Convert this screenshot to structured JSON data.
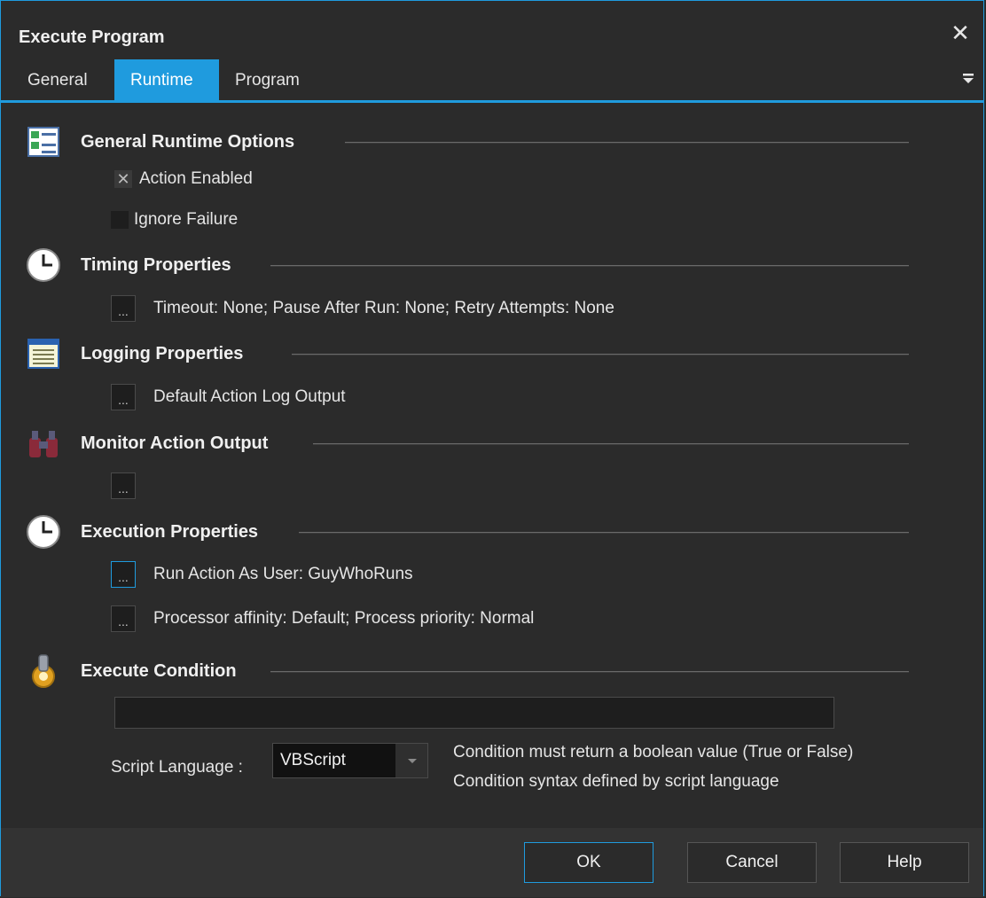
{
  "window": {
    "title": "Execute Program"
  },
  "tabs": [
    {
      "label": "General",
      "active": false
    },
    {
      "label": "Runtime",
      "active": true
    },
    {
      "label": "Program",
      "active": false
    }
  ],
  "sections": {
    "general_runtime": {
      "title": "General Runtime Options",
      "action_enabled": {
        "label": "Action Enabled",
        "checked": true
      },
      "ignore_failure": {
        "label": "Ignore Failure",
        "checked": false
      }
    },
    "timing": {
      "title": "Timing Properties",
      "summary": "Timeout: None; Pause After Run: None; Retry Attempts: None"
    },
    "logging": {
      "title": "Logging Properties",
      "summary": "Default Action Log Output"
    },
    "monitor": {
      "title": "Monitor Action Output",
      "summary": ""
    },
    "execution": {
      "title": "Execution Properties",
      "run_as": "Run Action As User: GuyWhoRuns",
      "affinity": "Processor affinity: Default; Process priority: Normal"
    },
    "condition": {
      "title": "Execute Condition",
      "value": "",
      "script_label": "Script Language :",
      "script_value": "VBScript",
      "hint_line1": "Condition must return a boolean value (True or False)",
      "hint_line2": "Condition syntax defined by script language"
    }
  },
  "buttons": {
    "ok": "OK",
    "cancel": "Cancel",
    "help": "Help"
  },
  "ellipsis": "...",
  "colors": {
    "accent": "#1f9bde",
    "background": "#2b2b2b",
    "footer": "#333333"
  }
}
